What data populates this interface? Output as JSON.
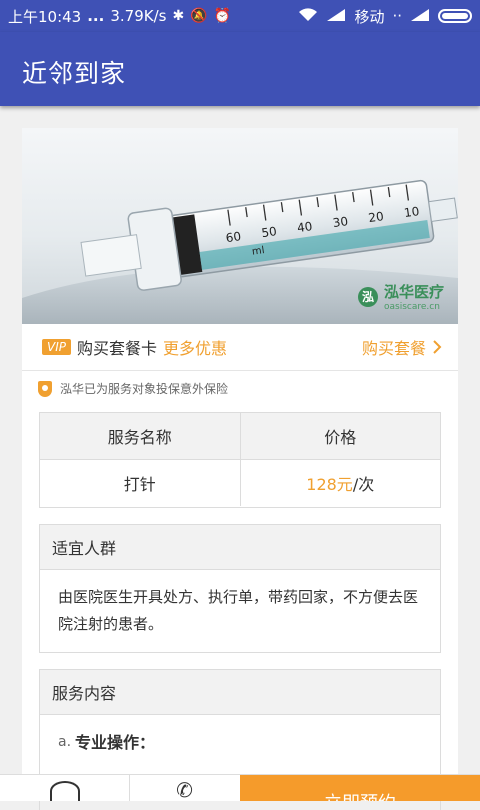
{
  "status_bar": {
    "time": "上午10:43",
    "dots": "...",
    "speed": "3.79K/s",
    "carrier": "移动",
    "carrier_suffix": "··",
    "icons": [
      "bluetooth-icon",
      "mute-icon",
      "alarm-icon",
      "wifi-icon",
      "signal-icon",
      "signal-icon",
      "battery-icon"
    ]
  },
  "app_bar": {
    "title": "近邻到家"
  },
  "hero": {
    "watermark_name": "泓华医疗",
    "watermark_sub": "oasiscare.cn",
    "watermark_logo": "泓",
    "syringe_marks": [
      "10",
      "20",
      "30",
      "40",
      "50",
      "60"
    ],
    "syringe_unit": "ml"
  },
  "vip": {
    "badge": "VIP",
    "text": "购买套餐卡",
    "more": "更多优惠",
    "buy_label": "购买套餐"
  },
  "insurance_note": "泓华已为服务对象投保意外保险",
  "service_table": {
    "headers": [
      "服务名称",
      "价格"
    ],
    "rows": [
      {
        "name": "打针",
        "price_num": "128元",
        "price_unit": "/次"
      }
    ]
  },
  "suitable": {
    "title": "适宜人群",
    "body": "由医院医生开具处方、执行单，带药回家，不方便去医院注射的患者。"
  },
  "service_content": {
    "title": "服务内容",
    "item_index": "a.",
    "item_label": "专业操作："
  },
  "bottom_bar": {
    "book_label": "立即预约"
  },
  "colors": {
    "primary": "#3f51b5",
    "accent": "#f0a030",
    "book_button": "#f59b2b"
  }
}
